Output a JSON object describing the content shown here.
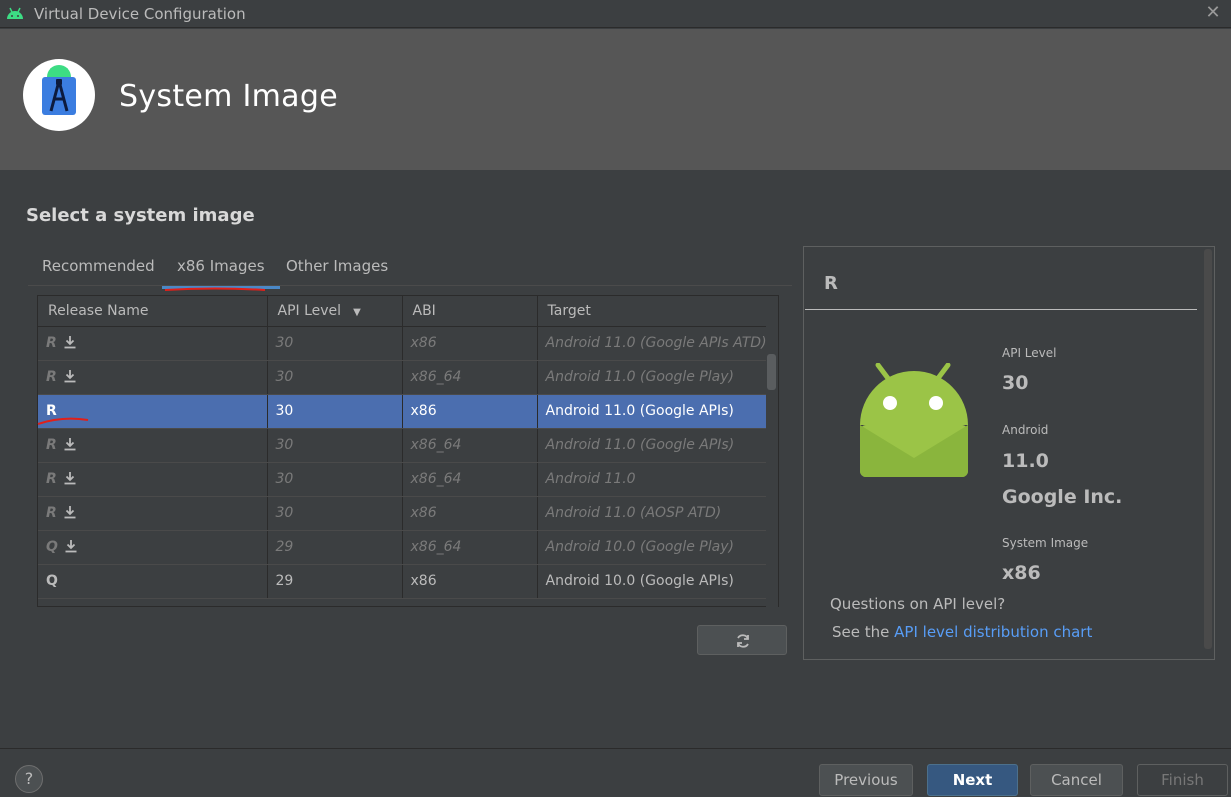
{
  "window": {
    "title": "Virtual Device Configuration"
  },
  "header": {
    "title": "System Image"
  },
  "main": {
    "section_title": "Select a system image",
    "tabs": [
      {
        "label": "Recommended"
      },
      {
        "label": "x86 Images"
      },
      {
        "label": "Other Images"
      }
    ],
    "active_tab": "x86 Images",
    "table": {
      "columns": [
        "Release Name",
        "API Level",
        "ABI",
        "Target"
      ],
      "sorted_column": "API Level",
      "rows": [
        {
          "name": "R",
          "download": true,
          "api": "30",
          "abi": "x86",
          "target": "Android 11.0 (Google APIs ATD)"
        },
        {
          "name": "R",
          "download": true,
          "api": "30",
          "abi": "x86_64",
          "target": "Android 11.0 (Google Play)"
        },
        {
          "name": "R",
          "download": false,
          "api": "30",
          "abi": "x86",
          "target": "Android 11.0 (Google APIs)",
          "selected": true
        },
        {
          "name": "R",
          "download": true,
          "api": "30",
          "abi": "x86_64",
          "target": "Android 11.0 (Google APIs)"
        },
        {
          "name": "R",
          "download": true,
          "api": "30",
          "abi": "x86_64",
          "target": "Android 11.0"
        },
        {
          "name": "R",
          "download": true,
          "api": "30",
          "abi": "x86",
          "target": "Android 11.0 (AOSP ATD)"
        },
        {
          "name": "Q",
          "download": true,
          "api": "29",
          "abi": "x86_64",
          "target": "Android 10.0 (Google Play)"
        },
        {
          "name": "Q",
          "download": false,
          "api": "29",
          "abi": "x86",
          "target": "Android 10.0 (Google APIs)"
        }
      ]
    }
  },
  "detail": {
    "release": "R",
    "api_level_label": "API Level",
    "api_level": "30",
    "android_label": "Android",
    "android_version": "11.0",
    "vendor": "Google Inc.",
    "system_image_label": "System Image",
    "system_image": "x86",
    "question": "Questions on API level?",
    "see_the": "See the",
    "link": "API level distribution chart"
  },
  "footer": {
    "help": "?",
    "previous": "Previous",
    "next": "Next",
    "cancel": "Cancel",
    "finish": "Finish"
  },
  "colors": {
    "selection": "#4b6eaf",
    "tab_underline": "#4a88c7",
    "link": "#589df6",
    "android_green": "#9bc447",
    "annotation_red": "#e0201a"
  },
  "icons": [
    "android-icon",
    "android-studio-logo",
    "close-icon",
    "download-icon",
    "refresh-icon",
    "sort-desc-icon",
    "android-robot"
  ]
}
